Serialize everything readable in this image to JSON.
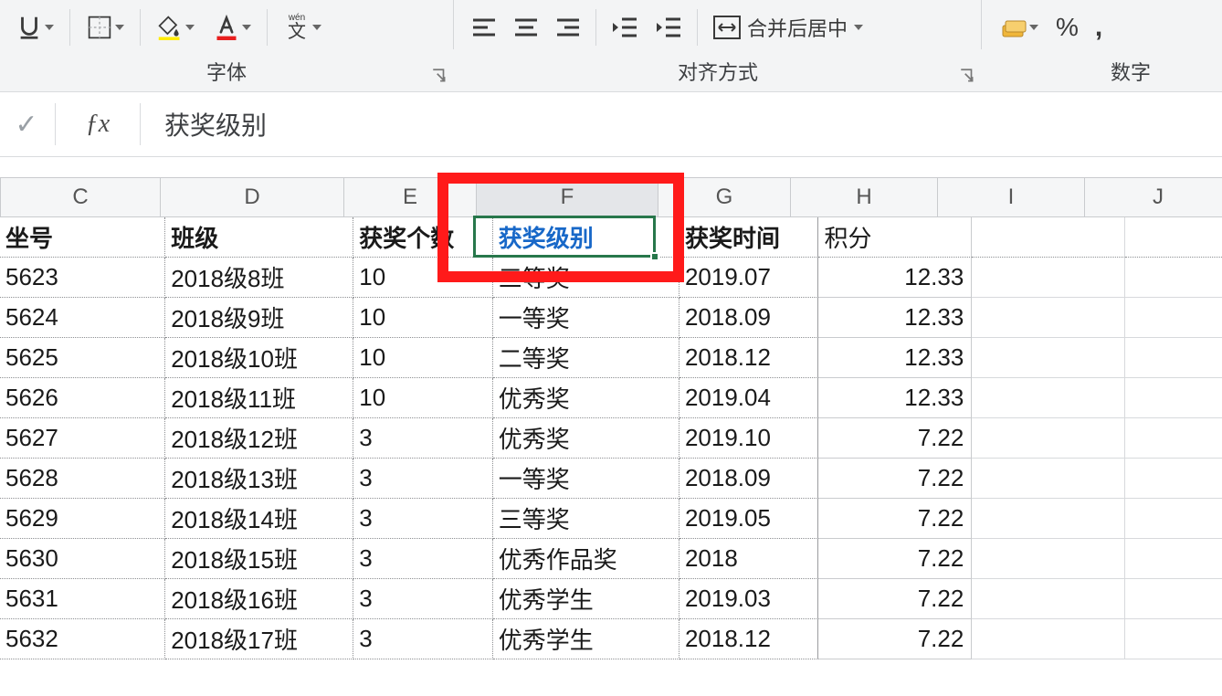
{
  "ribbon": {
    "font_group": "字体",
    "align_group": "对齐方式",
    "number_group": "数字",
    "merge_label": "合并后居中",
    "wen": "文"
  },
  "fbar": {
    "value": "获奖级别"
  },
  "columns": [
    "C",
    "D",
    "E",
    "F",
    "G",
    "H",
    "I",
    "J"
  ],
  "headers": {
    "C": "坐号",
    "D": "班级",
    "E": "获奖个数",
    "F": "获奖级别",
    "G": "获奖时间",
    "H": "积分"
  },
  "rows": [
    {
      "C": "5623",
      "D": "2018级8班",
      "E": "10",
      "F": "三等奖",
      "G": "2019.07",
      "H": "12.33"
    },
    {
      "C": "5624",
      "D": "2018级9班",
      "E": "10",
      "F": "一等奖",
      "G": "2018.09",
      "H": "12.33"
    },
    {
      "C": "5625",
      "D": "2018级10班",
      "E": "10",
      "F": "二等奖",
      "G": "2018.12",
      "H": "12.33"
    },
    {
      "C": "5626",
      "D": "2018级11班",
      "E": "10",
      "F": "优秀奖",
      "G": "2019.04",
      "H": "12.33"
    },
    {
      "C": "5627",
      "D": "2018级12班",
      "E": "3",
      "F": "优秀奖",
      "G": "2019.10",
      "H": "7.22"
    },
    {
      "C": "5628",
      "D": "2018级13班",
      "E": "3",
      "F": "一等奖",
      "G": "2018.09",
      "H": "7.22"
    },
    {
      "C": "5629",
      "D": "2018级14班",
      "E": "3",
      "F": "三等奖",
      "G": "2019.05",
      "H": "7.22"
    },
    {
      "C": "5630",
      "D": "2018级15班",
      "E": "3",
      "F": "优秀作品奖",
      "G": "2018",
      "H": "7.22"
    },
    {
      "C": "5631",
      "D": "2018级16班",
      "E": "3",
      "F": "优秀学生",
      "G": "2019.03",
      "H": "7.22"
    },
    {
      "C": "5632",
      "D": "2018级17班",
      "E": "3",
      "F": "优秀学生",
      "G": "2018.12",
      "H": "7.22"
    }
  ]
}
